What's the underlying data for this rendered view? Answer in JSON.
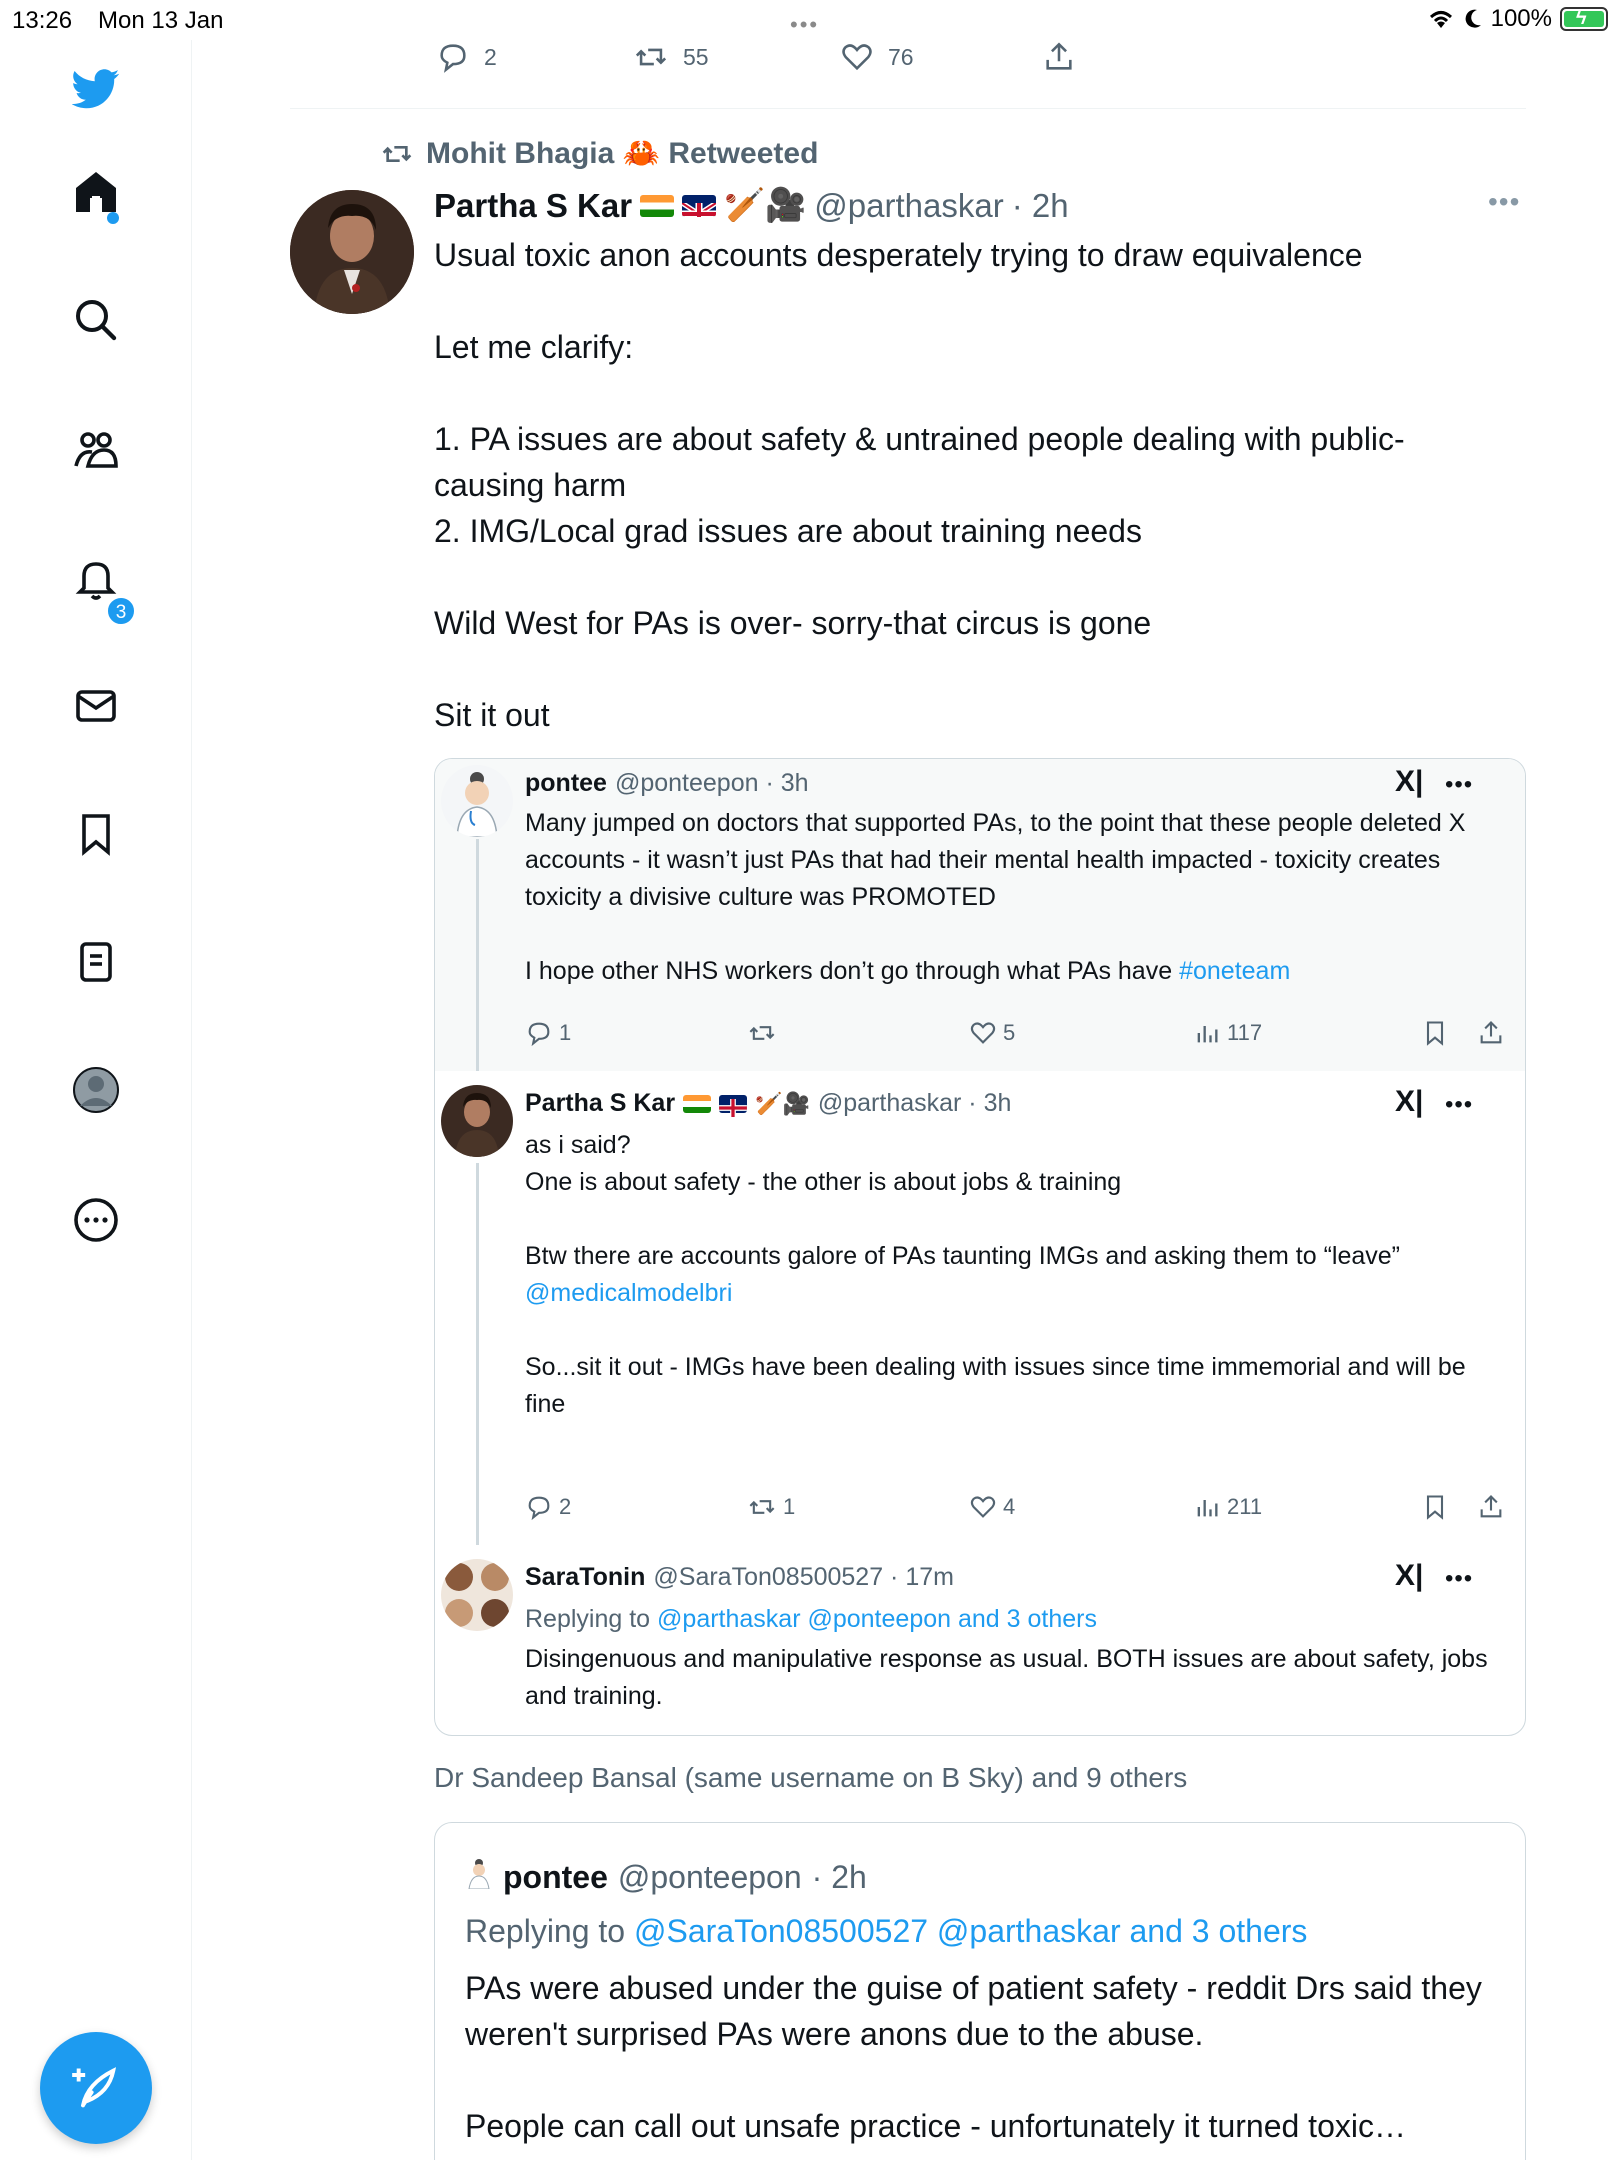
{
  "status_bar": {
    "time": "13:26",
    "date": "Mon 13 Jan",
    "battery": "100%"
  },
  "sidebar": {
    "notifications_badge": "3",
    "items": [
      {
        "icon": "twitter-logo-icon"
      },
      {
        "icon": "home-icon"
      },
      {
        "icon": "search-icon"
      },
      {
        "icon": "communities-icon"
      },
      {
        "icon": "notifications-bell-icon"
      },
      {
        "icon": "messages-envelope-icon"
      },
      {
        "icon": "bookmark-icon"
      },
      {
        "icon": "lists-icon"
      },
      {
        "icon": "profile-avatar-icon"
      },
      {
        "icon": "more-icon"
      }
    ],
    "compose_icon": "compose-feather-icon"
  },
  "prev_tweet_actions": {
    "replies": "2",
    "retweets": "55",
    "likes": "76"
  },
  "tweet": {
    "retweeted_by": "Mohit Bhagia 🦀 Retweeted",
    "author_name": "Partha S Kar",
    "author_emoji": "🏏🎥",
    "author_handle": "@parthaskar",
    "time": "· 2h",
    "text": "Usual toxic anon accounts desperately trying to draw equivalence\n\nLet me clarify:\n\n1. PA issues are about safety & untrained people dealing with public-causing harm\n2. IMG/Local grad issues are about training needs\n\nWild West for PAs is over- sorry-that circus is gone\n\nSit it out"
  },
  "embedded": {
    "post1": {
      "name": "pontee",
      "handle": "@ponteepon · 3h",
      "text_main": "Many jumped on doctors that supported PAs, to the point that these people deleted X accounts - it wasn’t just PAs that had their mental health impacted - toxicity creates toxicity a divisive culture was PROMOTED\n\nI hope other NHS workers don’t go through what PAs have ",
      "hashtag": "#oneteam",
      "replies": "1",
      "retweets": "",
      "likes": "5",
      "views": "117"
    },
    "post2": {
      "name": "Partha S Kar",
      "handle": "@parthaskar · 3h",
      "text_a": "as i said?\nOne is about safety - the other is about jobs & training\n\nBtw there are accounts galore of PAs taunting IMGs and asking them to “leave”",
      "mention": "@medicalmodelbri",
      "text_b": "So...sit it out - IMGs have been dealing with issues since time immemorial and will be fine",
      "replies": "2",
      "retweets": "1",
      "likes": "4",
      "views": "211"
    },
    "post3": {
      "name": "SaraTonin",
      "handle": "@SaraTon08500527 · 17m",
      "replying_prefix": "Replying to ",
      "replying_to": "@parthaskar @ponteepon and 3 others",
      "text": "Disingenuous and manipulative response as usual.  BOTH issues are about safety, jobs and training."
    },
    "x_logo": "X|"
  },
  "liked_by": "Dr Sandeep Bansal (same username on B Sky) and 9 others",
  "reply": {
    "name": "pontee",
    "handle": "@ponteepon",
    "time": "· 2h",
    "replying_prefix": "Replying to ",
    "replying_to": "@SaraTon08500527 @parthaskar and 3 others",
    "text": "PAs were abused under the guise of patient safety - reddit Drs said they weren't surprised PAs were anons due to the abuse.\n\nPeople can call out unsafe practice - unfortunately it turned toxic…"
  },
  "colors": {
    "accent": "#1d9bf0",
    "text": "#0f1419",
    "secondary": "#536471",
    "border": "#cfd9de"
  }
}
